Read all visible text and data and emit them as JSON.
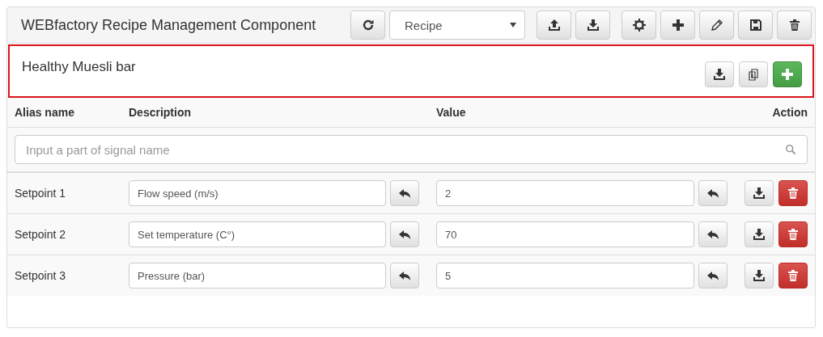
{
  "window": {
    "title": "WEBfactory Recipe Management Component"
  },
  "toolbar": {
    "recipe_select": {
      "value": "Recipe"
    }
  },
  "recipe": {
    "name": "Healthy Muesli bar"
  },
  "table": {
    "columns": [
      "Alias name",
      "Description",
      "Value",
      "Action"
    ],
    "search": {
      "placeholder": "Input a part of signal name"
    },
    "rows": [
      {
        "alias": "Setpoint 1",
        "description": "Flow speed (m/s)",
        "value": "2"
      },
      {
        "alias": "Setpoint 2",
        "description": "Set temperature (C°)",
        "value": "70"
      },
      {
        "alias": "Setpoint 3",
        "description": "Pressure (bar)",
        "value": "5"
      }
    ]
  }
}
